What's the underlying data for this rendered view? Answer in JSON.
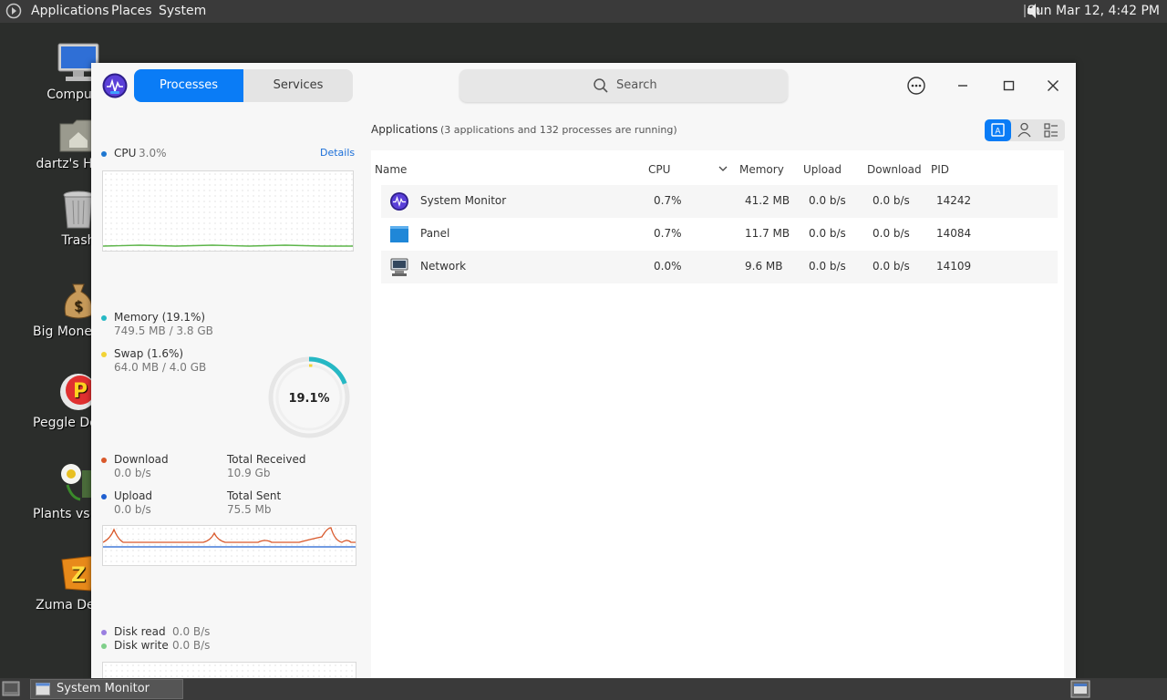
{
  "top_panel": {
    "menus": [
      "Applications",
      "Places",
      "System"
    ],
    "clock": "Sun Mar 12,  4:42 PM"
  },
  "desktop_icons": [
    {
      "label": "Computer",
      "icon": "computer-icon"
    },
    {
      "label": "dartz's Home",
      "icon": "home-folder-icon"
    },
    {
      "label": "Trash",
      "icon": "trash-icon"
    },
    {
      "label": "Big Money Deluxe",
      "icon": "money-bag-icon"
    },
    {
      "label": "Peggle Deluxe",
      "icon": "peggle-icon"
    },
    {
      "label": "Plants vs Zombies",
      "icon": "flower-icon"
    },
    {
      "label": "Zuma Deluxe",
      "icon": "zuma-icon"
    }
  ],
  "window": {
    "tabs": [
      {
        "label": "Processes",
        "active": true
      },
      {
        "label": "Services",
        "active": false
      }
    ],
    "search_label": "Search",
    "left_pane": {
      "cpu": {
        "label": "CPU",
        "value": "3.0%",
        "details_label": "Details",
        "color": "#1f77d0",
        "line_color": "#5db54a"
      },
      "memory": {
        "label": "Memory (19.1%)",
        "value": "749.5 MB / 3.8 GB",
        "color": "#26b8c4",
        "percent_text": "19.1%",
        "fraction": 0.191
      },
      "swap": {
        "label": "Swap (1.6%)",
        "value": "64.0 MB / 4.0 GB",
        "color": "#f2d336",
        "fraction": 0.016
      },
      "download": {
        "label": "Download",
        "value": "0.0 b/s",
        "color": "#d9582a"
      },
      "total_received": {
        "label": "Total Received",
        "value": "10.9 Gb"
      },
      "upload": {
        "label": "Upload",
        "value": "0.0 b/s",
        "color": "#1f5fd0"
      },
      "total_sent": {
        "label": "Total Sent",
        "value": "75.5 Mb"
      },
      "disk_read": {
        "label": "Disk read",
        "value": "0.0 B/s",
        "color": "#9a7fe0"
      },
      "disk_write": {
        "label": "Disk write",
        "value": "0.0 B/s",
        "color": "#7fcf8a"
      }
    },
    "apps_header": "Applications",
    "apps_count": "(3 applications and 132 processes are running)",
    "columns": [
      "Name",
      "CPU",
      "Memory",
      "Upload",
      "Download",
      "PID"
    ],
    "rows": [
      {
        "name": "System Monitor",
        "icon": "system-monitor-icon",
        "cpu": "0.7%",
        "memory": "41.2 MB",
        "upload": "0.0 b/s",
        "download": "0.0 b/s",
        "pid": "14242"
      },
      {
        "name": "Panel",
        "icon": "panel-icon",
        "cpu": "0.7%",
        "memory": "11.7 MB",
        "upload": "0.0 b/s",
        "download": "0.0 b/s",
        "pid": "14084"
      },
      {
        "name": "Network",
        "icon": "network-icon",
        "cpu": "0.0%",
        "memory": "9.6 MB",
        "upload": "0.0 b/s",
        "download": "0.0 b/s",
        "pid": "14109"
      }
    ]
  },
  "taskbar": {
    "task_label": "System Monitor"
  }
}
